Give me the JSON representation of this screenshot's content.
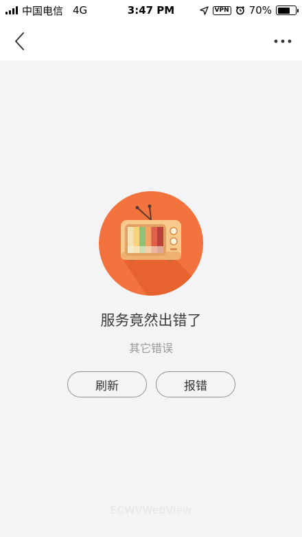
{
  "status_bar": {
    "carrier": "中国电信",
    "network": "4G",
    "time": "3:47 PM",
    "vpn": "VPN",
    "battery": "70%",
    "battery_level": 0.7
  },
  "nav": {
    "back_icon": "chevron-left-icon",
    "more_icon": "more-dots-icon"
  },
  "error": {
    "illustration_icon": "tv-icon",
    "title": "服务竟然出错了",
    "subtitle": "其它错误"
  },
  "actions": {
    "refresh_label": "刷新",
    "report_label": "报错"
  },
  "footer": {
    "watermark": "ECWVWebView"
  },
  "colors": {
    "accent": "#f2733e",
    "background": "#f4f4f6",
    "button_border": "#8f8f8f"
  }
}
